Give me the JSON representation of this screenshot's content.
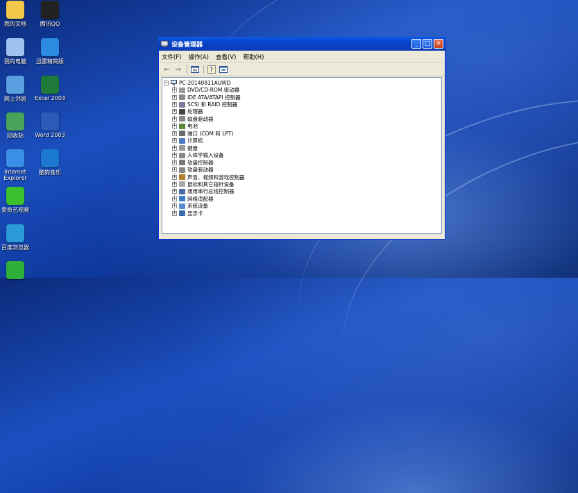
{
  "desktop": {
    "icons": [
      {
        "label": "我的文档",
        "icon": "my-documents-icon",
        "color": "#f3c84a"
      },
      {
        "label": "腾讯QQ",
        "icon": "qq-icon",
        "color": "#222222"
      },
      {
        "label": "我的电脑",
        "icon": "my-computer-icon",
        "color": "#9fc3f0"
      },
      {
        "label": "迅雷精简版",
        "icon": "xunlei-icon",
        "color": "#2a8be0"
      },
      {
        "label": "网上邻居",
        "icon": "network-places-icon",
        "color": "#5aa0e0"
      },
      {
        "label": "Excel 2003",
        "icon": "excel-icon",
        "color": "#1f7a3a"
      },
      {
        "label": "回收站",
        "icon": "recycle-bin-icon",
        "color": "#4aa35a"
      },
      {
        "label": "Word 2003",
        "icon": "word-icon",
        "color": "#2a5bb8"
      },
      {
        "label": "Internet Explorer",
        "icon": "ie-icon",
        "color": "#3a8ee8"
      },
      {
        "label": "酷狗音乐",
        "icon": "kugou-icon",
        "color": "#1a78d0"
      },
      {
        "label": "爱奇艺视频",
        "icon": "iqiyi-icon",
        "color": "#3cbf2c"
      },
      {
        "label": "百度浏览器",
        "icon": "baidu-browser-icon",
        "color": "#2a9ad8"
      },
      {
        "label": "",
        "icon": "security-shield-icon",
        "color": "#2fae3a"
      }
    ]
  },
  "window": {
    "title": "设备管理器",
    "buttons": {
      "minimize": "_",
      "maximize": "□",
      "close": "×"
    },
    "menu": [
      "文件(F)",
      "操作(A)",
      "查看(V)",
      "帮助(H)"
    ],
    "toolbar": [
      "back-icon",
      "forward-icon",
      "properties-icon",
      "help-icon",
      "refresh-icon"
    ],
    "tree": {
      "root": "PC-20140811AUWD",
      "items": [
        {
          "label": "DVD/CD-ROM 驱动器",
          "icon": "cdrom-icon",
          "color": "#9a9a9a"
        },
        {
          "label": "IDE ATA/ATAPI 控制器",
          "icon": "ide-controller-icon",
          "color": "#8a8a8a"
        },
        {
          "label": "SCSI 和 RAID 控制器",
          "icon": "scsi-icon",
          "color": "#7a7a9a"
        },
        {
          "label": "处理器",
          "icon": "processor-icon",
          "color": "#444444"
        },
        {
          "label": "磁盘驱动器",
          "icon": "disk-drive-icon",
          "color": "#888888"
        },
        {
          "label": "电池",
          "icon": "battery-icon",
          "color": "#5a8a3a"
        },
        {
          "label": "端口 (COM 和 LPT)",
          "icon": "port-icon",
          "color": "#6a6a6a"
        },
        {
          "label": "计算机",
          "icon": "computer-icon",
          "color": "#4a7ac0"
        },
        {
          "label": "键盘",
          "icon": "keyboard-icon",
          "color": "#999999"
        },
        {
          "label": "人体学输入设备",
          "icon": "hid-icon",
          "color": "#8a8a8a"
        },
        {
          "label": "软盘控制器",
          "icon": "floppy-controller-icon",
          "color": "#7a7a7a"
        },
        {
          "label": "软盘驱动器",
          "icon": "floppy-drive-icon",
          "color": "#888888"
        },
        {
          "label": "声音、视频和游戏控制器",
          "icon": "sound-icon",
          "color": "#b08030"
        },
        {
          "label": "鼠标和其它指针设备",
          "icon": "mouse-icon",
          "color": "#aaaaaa"
        },
        {
          "label": "通用串行总线控制器",
          "icon": "usb-icon",
          "color": "#4a6aa0"
        },
        {
          "label": "网络适配器",
          "icon": "network-adapter-icon",
          "color": "#3a7ac8"
        },
        {
          "label": "系统设备",
          "icon": "system-device-icon",
          "color": "#5a8ad0"
        },
        {
          "label": "显示卡",
          "icon": "display-adapter-icon",
          "color": "#3a6ab0"
        }
      ]
    }
  }
}
